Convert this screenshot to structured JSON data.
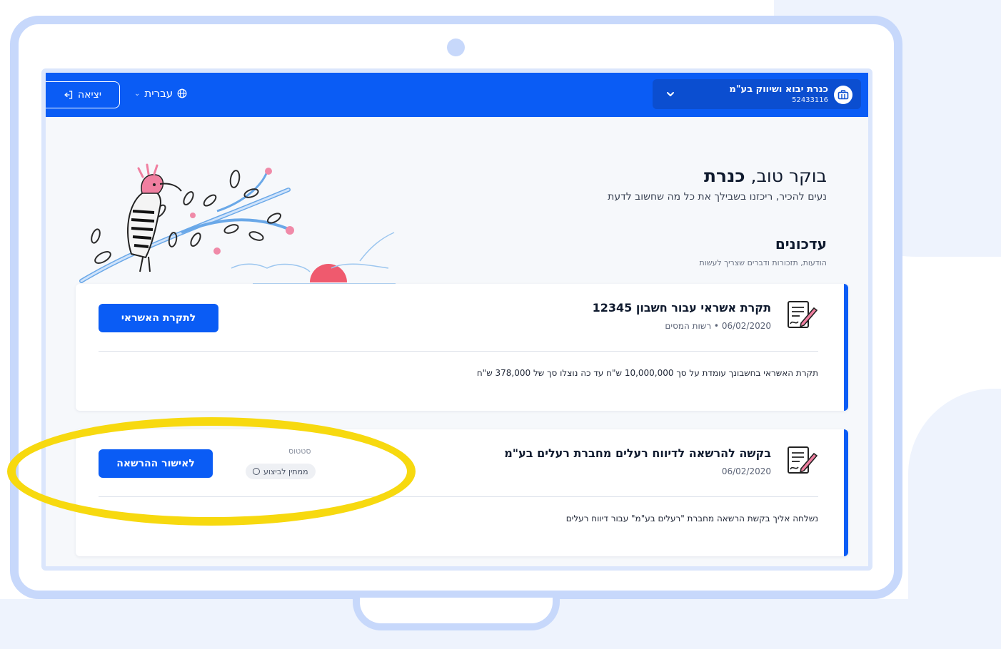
{
  "header": {
    "company_name": "כנרת יבוא ושיווק בע\"מ",
    "company_id": "52433116",
    "language": "עברית",
    "logout_label": "יציאה"
  },
  "greeting": {
    "prefix": "בוקר טוב,",
    "name": "כנרת",
    "subtitle": "נעים להכיר, ריכזנו בשבילך את כל מה שחשוב לדעת"
  },
  "updates": {
    "title": "עדכונים",
    "subtitle": "הודעות, תזכורות ודברים שצריך לעשות"
  },
  "cards": [
    {
      "title": "תקרת אשראי עבור חשבון 12345",
      "date": "06/02/2020",
      "source": "רשות המסים",
      "description": "תקרת האשראי בחשבונך עומדת על סך 10,000,000 ש\"ח עד כה נוצלו סך של 378,000 ש\"ח",
      "button_label": "לתקרת האשראי"
    },
    {
      "title": "בקשה להרשאה לדיווח רעלים מחברת רעלים בע\"מ",
      "date": "06/02/2020",
      "status_label": "סטטוס",
      "status_value": "ממתין לביצוע",
      "description": "נשלחה אליך בקשת הרשאה מחברת \"רעלים בע\"מ\" עבור דיווח רעלים",
      "button_label": "לאישור ההרשאה"
    }
  ],
  "colors": {
    "primary": "#0a5cf5",
    "highlight": "#f7d90f",
    "frame": "#c7d8fb"
  }
}
